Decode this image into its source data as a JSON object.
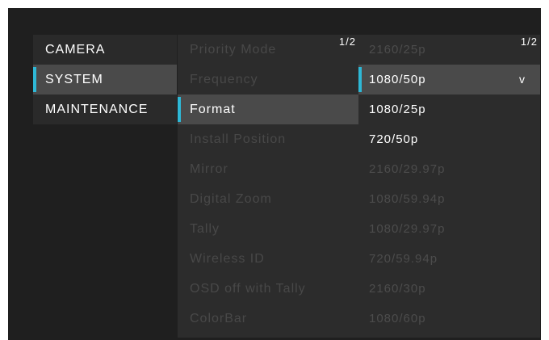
{
  "main_menu": {
    "items": [
      {
        "label": "CAMERA"
      },
      {
        "label": "SYSTEM"
      },
      {
        "label": "MAINTENANCE"
      }
    ],
    "selected": "SYSTEM"
  },
  "submenu": {
    "page_indicator": "1/2",
    "items": [
      {
        "label": "Priority Mode"
      },
      {
        "label": "Frequency"
      },
      {
        "label": "Format"
      },
      {
        "label": "Install Position"
      },
      {
        "label": "Mirror"
      },
      {
        "label": "Digital Zoom"
      },
      {
        "label": "Tally"
      },
      {
        "label": "Wireless ID"
      },
      {
        "label": "OSD off with Tally"
      },
      {
        "label": "ColorBar"
      }
    ],
    "active": "Format"
  },
  "options": {
    "page_indicator": "1/2",
    "items": [
      {
        "label": "2160/25p"
      },
      {
        "label": "1080/50p",
        "check": "v"
      },
      {
        "label": "1080/25p"
      },
      {
        "label": "720/50p"
      },
      {
        "label": "2160/29.97p"
      },
      {
        "label": "1080/59.94p"
      },
      {
        "label": "1080/29.97p"
      },
      {
        "label": "720/59.94p"
      },
      {
        "label": "2160/30p"
      },
      {
        "label": "1080/60p"
      }
    ],
    "selected": "1080/50p",
    "enabled": [
      "1080/50p",
      "1080/25p",
      "720/50p"
    ]
  },
  "colors": {
    "accent": "#2eb8d6",
    "background": "#1f1f1f",
    "panel": "#2c2c2c",
    "highlight": "#4a4a4a",
    "disabled_text": "#484848"
  }
}
